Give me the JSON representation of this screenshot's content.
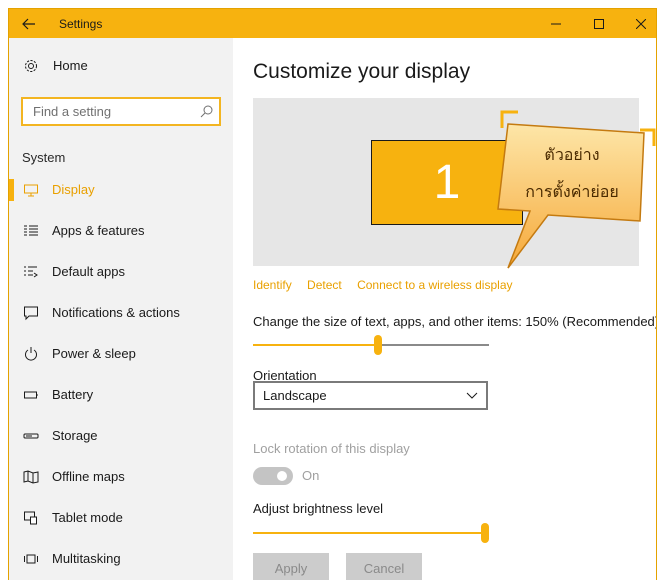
{
  "window": {
    "title": "Settings",
    "accent_color": "#f7b20f",
    "icons": {
      "back": "back-arrow-icon",
      "minimize": "minimize-icon",
      "maximize": "maximize-icon",
      "close": "close-icon"
    }
  },
  "sidebar": {
    "home_label": "Home",
    "search_placeholder": "Find a setting",
    "section_label": "System",
    "items": [
      {
        "label": "Display",
        "icon": "display-icon",
        "active": true
      },
      {
        "label": "Apps & features",
        "icon": "apps-features-icon",
        "active": false
      },
      {
        "label": "Default apps",
        "icon": "default-apps-icon",
        "active": false
      },
      {
        "label": "Notifications & actions",
        "icon": "notifications-icon",
        "active": false
      },
      {
        "label": "Power & sleep",
        "icon": "power-icon",
        "active": false
      },
      {
        "label": "Battery",
        "icon": "battery-icon",
        "active": false
      },
      {
        "label": "Storage",
        "icon": "storage-icon",
        "active": false
      },
      {
        "label": "Offline maps",
        "icon": "map-icon",
        "active": false
      },
      {
        "label": "Tablet mode",
        "icon": "tablet-mode-icon",
        "active": false
      },
      {
        "label": "Multitasking",
        "icon": "multitasking-icon",
        "active": false
      }
    ]
  },
  "main": {
    "title": "Customize your display",
    "monitor_number": "1",
    "links": [
      "Identify",
      "Detect",
      "Connect to a wireless display"
    ],
    "scale_label": "Change the size of text, apps, and other items: 150% (Recommended)",
    "scale_level": 0.53,
    "orientation_label": "Orientation",
    "orientation_value": "Landscape",
    "lock_rotation_label": "Lock rotation of this display",
    "lock_rotation_state": "On",
    "brightness_label": "Adjust brightness level",
    "brightness_level": 1.0,
    "apply_label": "Apply",
    "cancel_label": "Cancel"
  },
  "callout": {
    "line1": "ตัวอย่าง",
    "line2": "การตั้งค่าย่อย"
  }
}
